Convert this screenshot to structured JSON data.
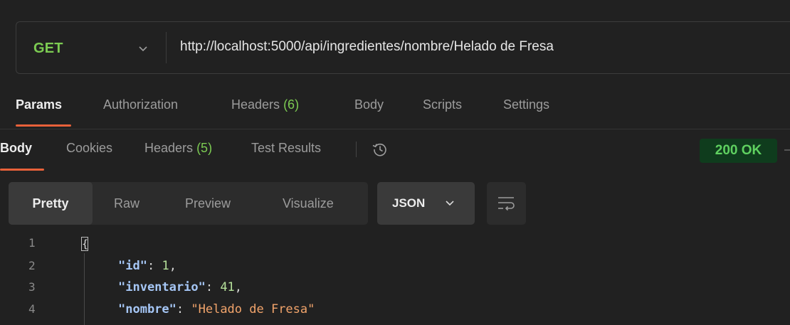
{
  "request": {
    "method": "GET",
    "url": "http://localhost:5000/api/ingredientes/nombre/Helado de Fresa"
  },
  "request_tabs": [
    {
      "label": "Params",
      "active": true
    },
    {
      "label": "Authorization"
    },
    {
      "label": "Headers",
      "count": "(6)"
    },
    {
      "label": "Body"
    },
    {
      "label": "Scripts"
    },
    {
      "label": "Settings"
    }
  ],
  "response_tabs": [
    {
      "label": "Body",
      "active": true
    },
    {
      "label": "Cookies"
    },
    {
      "label": "Headers",
      "count": "(5)"
    },
    {
      "label": "Test Results"
    }
  ],
  "status": "200 OK",
  "format_tabs": [
    "Pretty",
    "Raw",
    "Preview",
    "Visualize"
  ],
  "language": "JSON",
  "code": {
    "line_numbers": [
      "1",
      "2",
      "3",
      "4"
    ],
    "open_brace": "{",
    "lines": [
      {
        "key": "\"id\"",
        "colon": ": ",
        "value": "1",
        "trail": ","
      },
      {
        "key": "\"inventario\"",
        "colon": ": ",
        "value": "41",
        "trail": ","
      },
      {
        "key": "\"nombre\"",
        "colon": ": ",
        "value": "\"Helado de Fresa\"",
        "trail": ""
      }
    ]
  },
  "colors": {
    "accent": "#e8613a",
    "method": "#7ccb52",
    "status_bg": "#0f3c1d",
    "status_text": "#5fd160"
  },
  "icons": [
    "chevron-down-icon",
    "history-icon",
    "wrap-lines-icon"
  ]
}
